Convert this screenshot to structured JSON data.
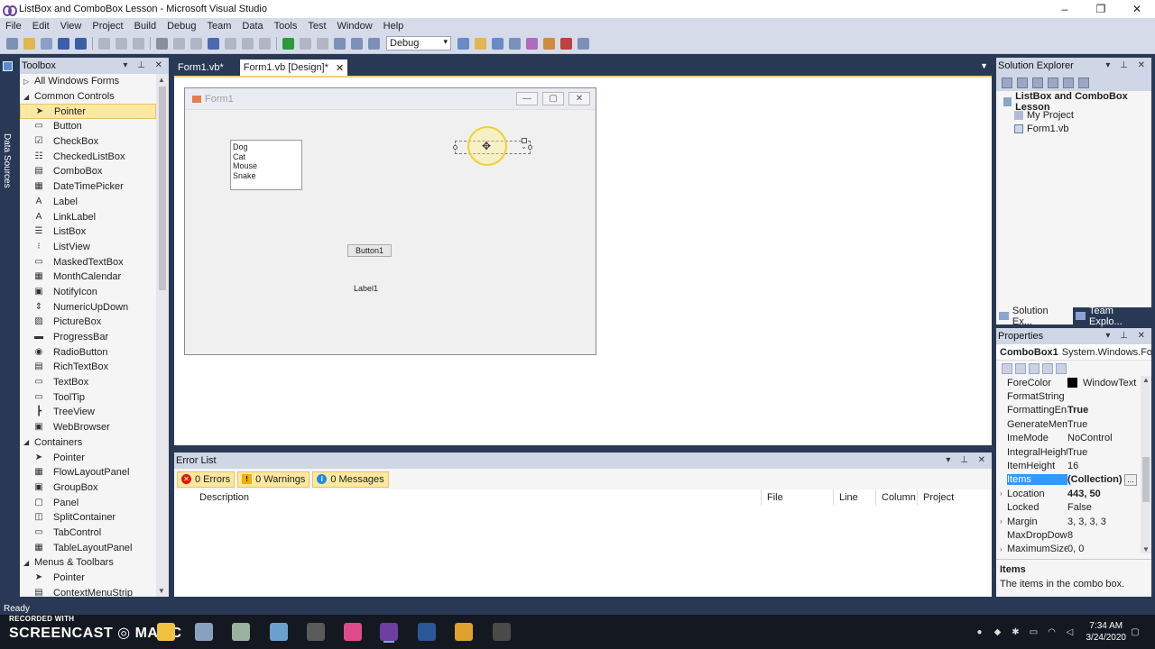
{
  "window": {
    "title": "ListBox and ComboBox Lesson - Microsoft Visual Studio",
    "controls": [
      "–",
      "❐",
      "✕"
    ]
  },
  "menu": [
    "File",
    "Edit",
    "View",
    "Project",
    "Build",
    "Debug",
    "Team",
    "Data",
    "Tools",
    "Test",
    "Window",
    "Help"
  ],
  "toolbar": {
    "configuration": "Debug"
  },
  "data_sources_label": "Data Sources",
  "toolbox": {
    "title": "Toolbox",
    "items": [
      {
        "type": "group",
        "label": "All Windows Forms",
        "expanded": false
      },
      {
        "type": "group",
        "label": "Common Controls",
        "expanded": true
      },
      {
        "type": "item",
        "label": "Pointer",
        "icon": "pointer-icon",
        "glyph": "➤",
        "selected": true
      },
      {
        "type": "item",
        "label": "Button",
        "icon": "button-icon",
        "glyph": "▭"
      },
      {
        "type": "item",
        "label": "CheckBox",
        "icon": "checkbox-icon",
        "glyph": "☑"
      },
      {
        "type": "item",
        "label": "CheckedListBox",
        "icon": "checkedlistbox-icon",
        "glyph": "☷"
      },
      {
        "type": "item",
        "label": "ComboBox",
        "icon": "combobox-icon",
        "glyph": "▤"
      },
      {
        "type": "item",
        "label": "DateTimePicker",
        "icon": "datetimepicker-icon",
        "glyph": "▦"
      },
      {
        "type": "item",
        "label": "Label",
        "icon": "label-icon",
        "glyph": "A"
      },
      {
        "type": "item",
        "label": "LinkLabel",
        "icon": "linklabel-icon",
        "glyph": "A"
      },
      {
        "type": "item",
        "label": "ListBox",
        "icon": "listbox-icon",
        "glyph": "☰"
      },
      {
        "type": "item",
        "label": "ListView",
        "icon": "listview-icon",
        "glyph": "⁝"
      },
      {
        "type": "item",
        "label": "MaskedTextBox",
        "icon": "maskedtextbox-icon",
        "glyph": "▭"
      },
      {
        "type": "item",
        "label": "MonthCalendar",
        "icon": "monthcalendar-icon",
        "glyph": "▦"
      },
      {
        "type": "item",
        "label": "NotifyIcon",
        "icon": "notifyicon-icon",
        "glyph": "▣"
      },
      {
        "type": "item",
        "label": "NumericUpDown",
        "icon": "numericupdown-icon",
        "glyph": "⇕"
      },
      {
        "type": "item",
        "label": "PictureBox",
        "icon": "picturebox-icon",
        "glyph": "▨"
      },
      {
        "type": "item",
        "label": "ProgressBar",
        "icon": "progressbar-icon",
        "glyph": "▬"
      },
      {
        "type": "item",
        "label": "RadioButton",
        "icon": "radiobutton-icon",
        "glyph": "◉"
      },
      {
        "type": "item",
        "label": "RichTextBox",
        "icon": "richtextbox-icon",
        "glyph": "▤"
      },
      {
        "type": "item",
        "label": "TextBox",
        "icon": "textbox-icon",
        "glyph": "▭"
      },
      {
        "type": "item",
        "label": "ToolTip",
        "icon": "tooltip-icon",
        "glyph": "▭"
      },
      {
        "type": "item",
        "label": "TreeView",
        "icon": "treeview-icon",
        "glyph": "┣"
      },
      {
        "type": "item",
        "label": "WebBrowser",
        "icon": "webbrowser-icon",
        "glyph": "▣"
      },
      {
        "type": "group",
        "label": "Containers",
        "expanded": true
      },
      {
        "type": "item",
        "label": "Pointer",
        "icon": "pointer-icon",
        "glyph": "➤"
      },
      {
        "type": "item",
        "label": "FlowLayoutPanel",
        "icon": "flowlayoutpanel-icon",
        "glyph": "▦"
      },
      {
        "type": "item",
        "label": "GroupBox",
        "icon": "groupbox-icon",
        "glyph": "▣"
      },
      {
        "type": "item",
        "label": "Panel",
        "icon": "panel-icon",
        "glyph": "▢"
      },
      {
        "type": "item",
        "label": "SplitContainer",
        "icon": "splitcontainer-icon",
        "glyph": "◫"
      },
      {
        "type": "item",
        "label": "TabControl",
        "icon": "tabcontrol-icon",
        "glyph": "▭"
      },
      {
        "type": "item",
        "label": "TableLayoutPanel",
        "icon": "tablelayoutpanel-icon",
        "glyph": "▦"
      },
      {
        "type": "group",
        "label": "Menus & Toolbars",
        "expanded": true
      },
      {
        "type": "item",
        "label": "Pointer",
        "icon": "pointer-icon",
        "glyph": "➤"
      },
      {
        "type": "item",
        "label": "ContextMenuStrip",
        "icon": "contextmenustrip-icon",
        "glyph": "▤"
      }
    ]
  },
  "doc_tabs": [
    {
      "label": "Form1.vb*",
      "active": false
    },
    {
      "label": "Form1.vb [Design]*",
      "active": true,
      "close": "✕"
    }
  ],
  "form": {
    "title": "Form1",
    "listbox_items": [
      "Dog",
      "Cat",
      "Mouse",
      "Snake"
    ],
    "button_text": "Button1",
    "label_text": "Label1"
  },
  "error_list": {
    "title": "Error List",
    "filters": [
      {
        "label": "0 Errors",
        "icon": "error-icon",
        "glyph": "✕",
        "color": "#e51400"
      },
      {
        "label": "0 Warnings",
        "icon": "warning-icon",
        "glyph": "!",
        "color": "#f0b000"
      },
      {
        "label": "0 Messages",
        "icon": "info-icon",
        "glyph": "i",
        "color": "#1e8de0"
      }
    ],
    "columns": [
      "Description",
      "File",
      "Line",
      "Column",
      "Project"
    ]
  },
  "solution_explorer": {
    "title": "Solution Explorer",
    "solution": "ListBox and ComboBox Lesson",
    "children": [
      "My Project",
      "Form1.vb"
    ],
    "tabs": [
      "Solution Ex...",
      "Team Explo..."
    ]
  },
  "properties": {
    "title": "Properties",
    "object_name": "ComboBox1",
    "object_type": "System.Windows.Form",
    "rows": [
      {
        "name": "ForeColor",
        "value": "WindowText",
        "swatch": "#000000"
      },
      {
        "name": "FormatString",
        "value": ""
      },
      {
        "name": "FormattingEna",
        "value": "True",
        "bold": true
      },
      {
        "name": "GenerateMem",
        "value": "True"
      },
      {
        "name": "ImeMode",
        "value": "NoControl"
      },
      {
        "name": "IntegralHeight",
        "value": "True"
      },
      {
        "name": "ItemHeight",
        "value": "16"
      },
      {
        "name": "Items",
        "value": "(Collection)",
        "bold": true,
        "selected": true,
        "dots": "..."
      },
      {
        "name": "Location",
        "value": "443, 50",
        "bold": true,
        "expandable": true
      },
      {
        "name": "Locked",
        "value": "False"
      },
      {
        "name": "Margin",
        "value": "3, 3, 3, 3",
        "expandable": true
      },
      {
        "name": "MaxDropDow",
        "value": "8"
      },
      {
        "name": "MaximumSize",
        "value": "0, 0",
        "expandable": true
      }
    ],
    "desc_title": "Items",
    "desc_text": "The items in the combo box."
  },
  "status": "Ready",
  "watermark": {
    "line1": "RECORDED WITH",
    "line2": "SCREENCAST ◎ MATIC"
  },
  "taskbar": {
    "apps": [
      {
        "icon": "file-explorer-icon",
        "color": "#f0c040"
      },
      {
        "icon": "app-icon-1",
        "color": "#8aa0c0"
      },
      {
        "icon": "app-icon-2",
        "color": "#9ab0a0"
      },
      {
        "icon": "app-icon-3",
        "color": "#6aa0d0"
      },
      {
        "icon": "calculator-icon",
        "color": "#5a5a5a"
      },
      {
        "icon": "itunes-icon",
        "color": "#e04a8a"
      },
      {
        "icon": "visual-studio-icon",
        "color": "#6a3fa0"
      },
      {
        "icon": "word-icon",
        "color": "#2b5797"
      },
      {
        "icon": "chrome-icon",
        "color": "#e0a030"
      },
      {
        "icon": "snipping-icon",
        "color": "#4a4a4a"
      }
    ],
    "time": "7:34 AM",
    "date": "3/24/2020"
  }
}
